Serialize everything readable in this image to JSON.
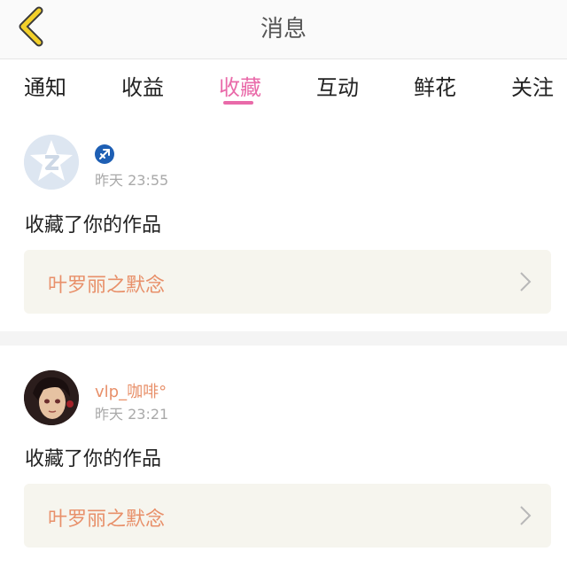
{
  "header": {
    "title": "消息",
    "back_icon": "chevron-left-icon"
  },
  "tabs": [
    {
      "label": "通知",
      "active": false
    },
    {
      "label": "收益",
      "active": false
    },
    {
      "label": "收藏",
      "active": true
    },
    {
      "label": "互动",
      "active": false
    },
    {
      "label": "鲜花",
      "active": false
    },
    {
      "label": "关注",
      "active": false
    }
  ],
  "colors": {
    "accent": "#e96aa9",
    "username": "#e8906a",
    "back_icon": "#f3d02a"
  },
  "notifications": [
    {
      "username": "",
      "badge_icon": "sagittarius-zodiac-icon",
      "time": "昨天 23:55",
      "action": "收藏了你的作品",
      "work_title": "叶罗丽之默念"
    },
    {
      "username": "vlp_咖啡°",
      "time": "昨天 23:21",
      "action": "收藏了你的作品",
      "work_title": "叶罗丽之默念"
    }
  ]
}
